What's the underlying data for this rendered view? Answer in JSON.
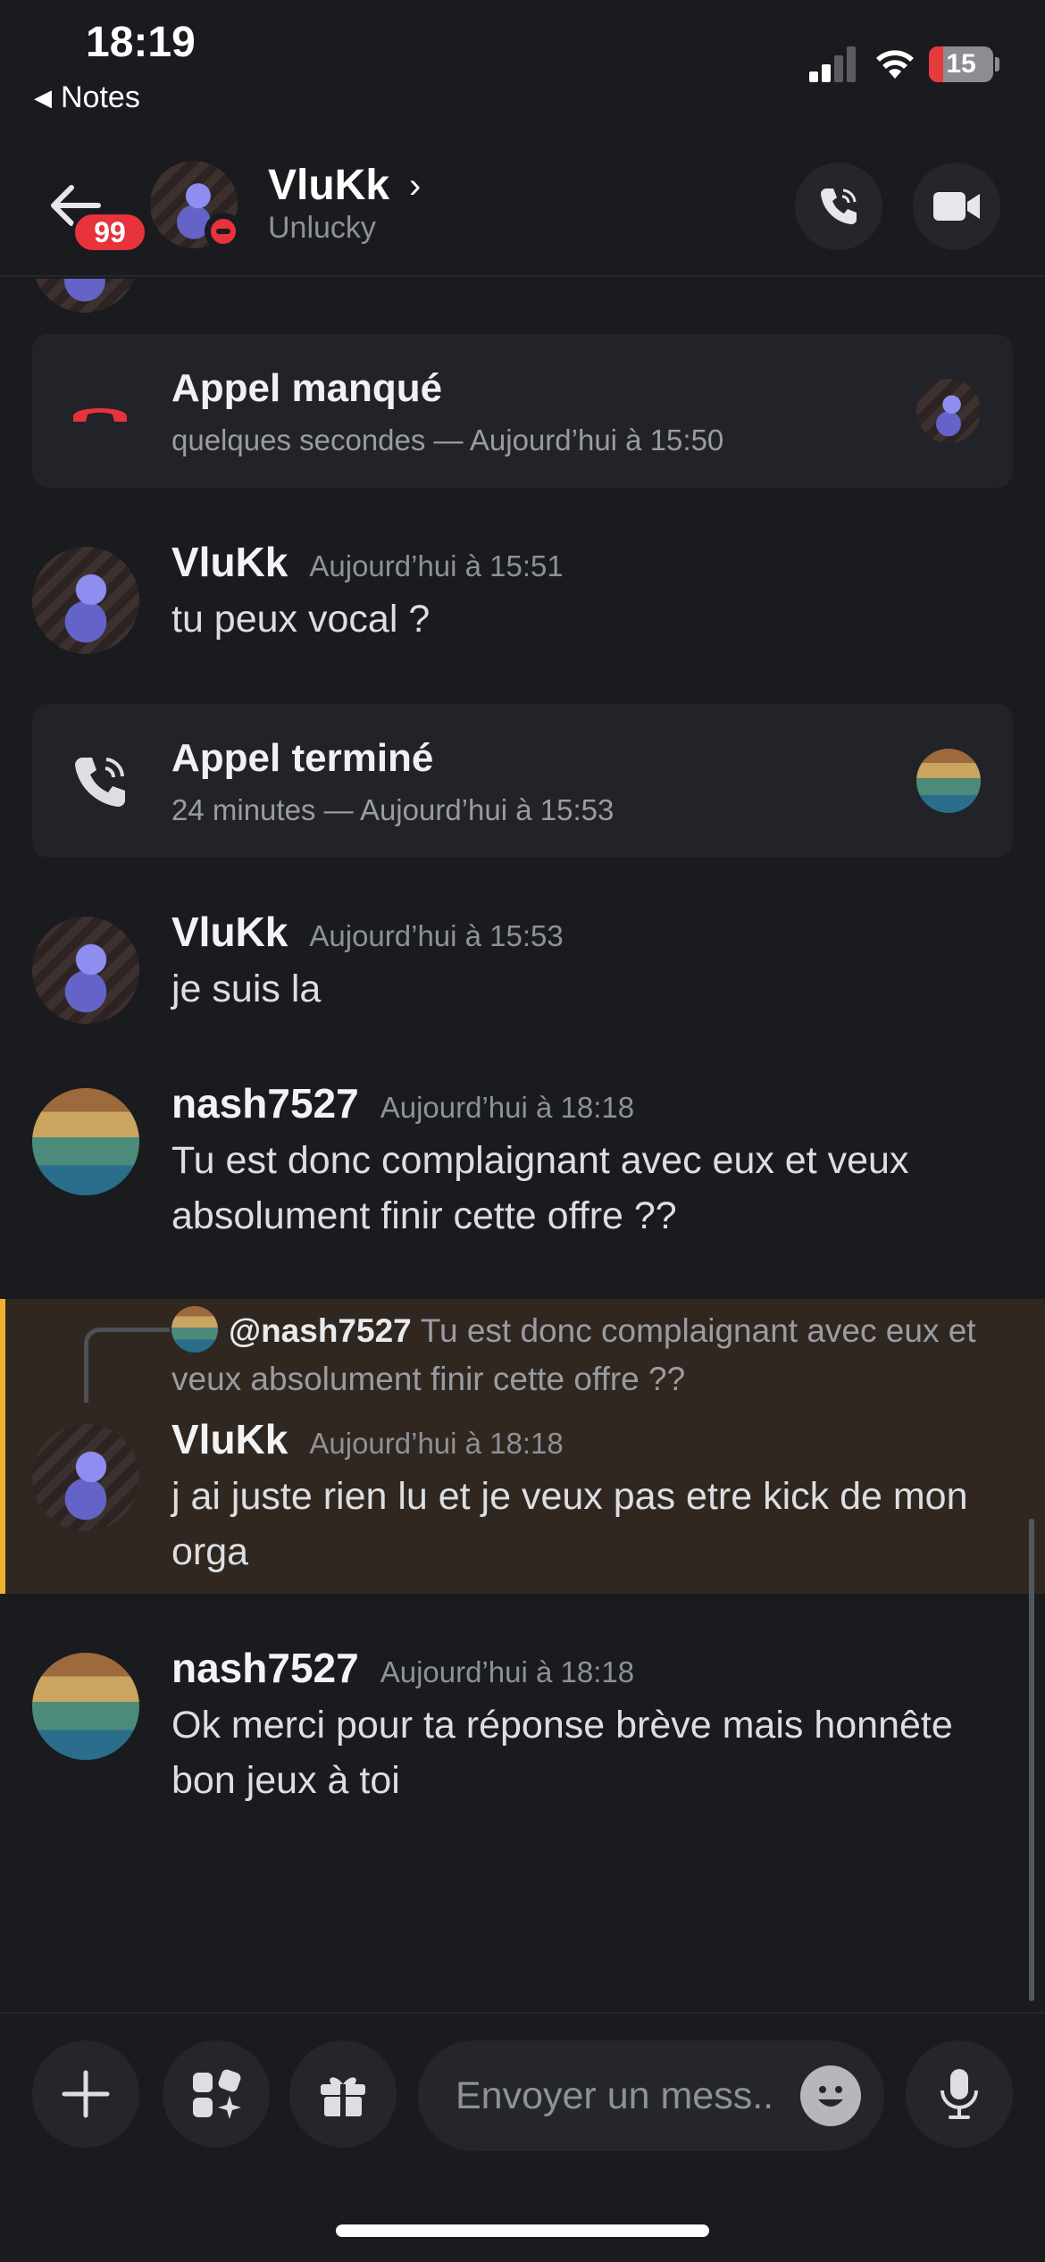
{
  "status_bar": {
    "time": "18:19",
    "back_app": "Notes",
    "battery": "15"
  },
  "header": {
    "unread_count": "99",
    "name": "VluKk",
    "status": "Unlucky"
  },
  "calls": [
    {
      "title": "Appel manqué",
      "subtitle": "quelques secondes — Aujourd’hui à 15:50",
      "type": "missed"
    },
    {
      "title": "Appel terminé",
      "subtitle": "24 minutes — Aujourd’hui à 15:53",
      "type": "ended"
    }
  ],
  "messages": [
    {
      "author": "VluKk",
      "time": "Aujourd’hui à 15:51",
      "text": "tu peux vocal ?"
    },
    {
      "author": "VluKk",
      "time": "Aujourd’hui à 15:53",
      "text": "je suis la"
    },
    {
      "author": "nash7527",
      "time": "Aujourd’hui à 18:18",
      "text": "Tu est donc complaignant avec eux et veux absolument finir cette offre ??"
    },
    {
      "author": "VluKk",
      "time": "Aujourd’hui à 18:18",
      "text": "j ai juste rien lu et je veux pas etre kick de mon orga",
      "reply": {
        "mention": "@nash7527",
        "text": "Tu est donc complaignant avec eux et veux absolument finir cette offre ??"
      }
    },
    {
      "author": "nash7527",
      "time": "Aujourd’hui à 18:18",
      "text": "Ok merci pour ta réponse brève mais honnête bon jeux à toi"
    }
  ],
  "composer": {
    "placeholder": "Envoyer un mess..."
  },
  "colors": {
    "background": "#1a1b1f",
    "card": "#222328",
    "missed_call": "#e8323c",
    "highlight_bar": "#f0b232",
    "highlight_bg": "#302820"
  }
}
